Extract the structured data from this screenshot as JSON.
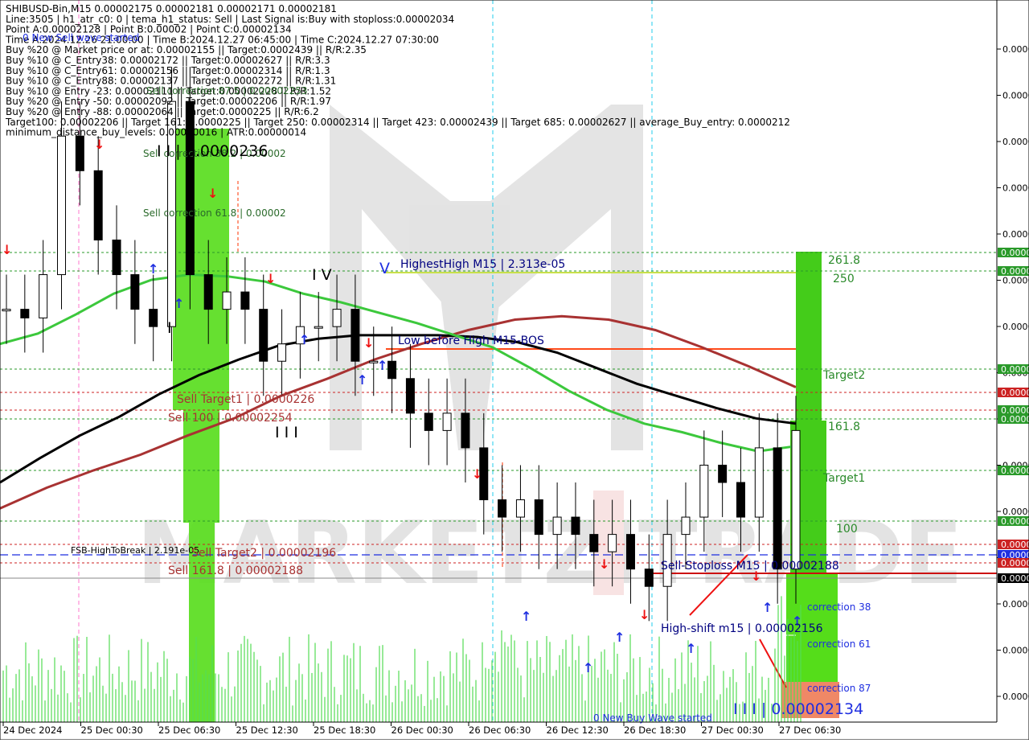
{
  "header_lines": [
    "SHIBUSD-Bin,M15  0.00002175 0.00002181 0.00002171 0.00002181",
    "Line:3505 | h1_atr_c0: 0 | tema_h1_status: Sell | Last Signal is:Buy with stoploss:0.00002034",
    "Point A:0.00002128 | Point B:0.00002 | Point C:0.00002134",
    "Time A:2024.12.26 21:00:00 | Time B:2024.12.27 06:45:00 | Time C:2024.12.27 07:30:00",
    "Buy %20 @ Market price or at: 0.00002155 || Target:0.0002439 || R/R:2.35",
    "Buy %10 @ C_Entry38: 0.00002172 || Target:0.00002627 || R/R:3.3",
    "Buy %10 @ C_Entry61: 0.00002156 || Target:0.00002314 || R/R:1.3",
    "Buy %10 @ C_Entry88: 0.00002137 || Target:0.00002272 || R/R:1.31",
    "Buy %10 @ Entry -23: 0.00002111 || Target:0.00002228 || R/R:1.52",
    "Buy %20 @ Entry -50: 0.00002092 || Target:0.00002206 || R/R:1.97",
    "Buy %20 @ Entry -88: 0.00002064 || Target:0.0000225 || R/R:6.2",
    "Target100: 0.00002206 || Target 161: 0.0000225 || Target 250: 0.00002314 || Target 423: 0.00002439 || Target 685: 0.00002627 || average_Buy_entry: 0.0000212",
    "minimum_distance_buy_levels: 0.00000016 | ATR:0.00000014"
  ],
  "chart_data": {
    "type": "candlestick",
    "symbol": "SHIBUSD-Bin",
    "timeframe": "M15",
    "ohlc_last": [
      2.175e-05,
      2.181e-05,
      2.171e-05,
      2.181e-05
    ],
    "x_ticks": [
      "24 Dec 2024",
      "25 Dec 00:30",
      "25 Dec 06:30",
      "25 Dec 12:30",
      "25 Dec 18:30",
      "26 Dec 00:30",
      "26 Dec 06:30",
      "26 Dec 12:30",
      "26 Dec 18:30",
      "27 Dec 00:30",
      "27 Dec 06:30"
    ],
    "y_tick_labels": [
      "0.0000",
      "0.0000",
      "0.0000",
      "0.0000",
      "0.0000",
      "0.0000",
      "0.0000",
      "0.0000",
      "0.0000",
      "0.0000",
      "0.0000",
      "0.0000",
      "0.0000",
      "0.0000",
      "0.0000",
      "0.0000"
    ],
    "price_tags": [
      {
        "text": "0.0000",
        "color": "#2a9a2a"
      },
      {
        "text": "0.0000",
        "color": "#2a9a2a"
      },
      {
        "text": "0.0000",
        "color": "#2a9a2a"
      },
      {
        "text": "0.0000",
        "color": "#cc2222"
      },
      {
        "text": "0.0000",
        "color": "#2a9a2a"
      },
      {
        "text": "0.0000",
        "color": "#2a9a2a"
      },
      {
        "text": "0.0000",
        "color": "#2a9a2a"
      },
      {
        "text": "0.0000",
        "color": "#2a9a2a"
      },
      {
        "text": "0.0000",
        "color": "#cc2222"
      },
      {
        "text": "0.0000",
        "color": "#1f2fe0"
      },
      {
        "text": "0.0000",
        "color": "#cc2222"
      },
      {
        "text": "0.0000",
        "color": "#000000"
      }
    ],
    "series": [
      {
        "kind": "ma-green",
        "color": "#3cc83c",
        "values": [
          2.22e-05,
          2.226e-05,
          2.237e-05,
          2.249e-05,
          2.257e-05,
          2.26e-05,
          2.259e-05,
          2.256e-05,
          2.249e-05,
          2.244e-05,
          2.238e-05,
          2.232e-05,
          2.225e-05,
          2.218e-05,
          2.206e-05,
          2.193e-05,
          2.182e-05,
          2.174e-05,
          2.169e-05,
          2.163e-05,
          2.158e-05,
          2.161e-05
        ]
      },
      {
        "kind": "ma-black",
        "color": "#000000",
        "values": [
          2.14e-05,
          2.154e-05,
          2.167e-05,
          2.178e-05,
          2.191e-05,
          2.202e-05,
          2.211e-05,
          2.219e-05,
          2.223e-05,
          2.225e-05,
          2.225e-05,
          2.225e-05,
          2.224e-05,
          2.221e-05,
          2.215e-05,
          2.206e-05,
          2.197e-05,
          2.19e-05,
          2.183e-05,
          2.177e-05,
          2.174e-05
        ]
      },
      {
        "kind": "ma-red",
        "color": "#a83232",
        "values": [
          2.125e-05,
          2.137e-05,
          2.147e-05,
          2.156e-05,
          2.167e-05,
          2.177e-05,
          2.19e-05,
          2.2e-05,
          2.211e-05,
          2.22e-05,
          2.228e-05,
          2.234e-05,
          2.236e-05,
          2.234e-05,
          2.228e-05,
          2.218e-05,
          2.207e-05,
          2.195e-05
        ]
      }
    ],
    "close": [
      2.24e-05,
      2.235e-05,
      2.26e-05,
      2.34e-05,
      2.32e-05,
      2.28e-05,
      2.26e-05,
      2.24e-05,
      2.23e-05,
      2.36e-05,
      2.26e-05,
      2.24e-05,
      2.25e-05,
      2.24e-05,
      2.21e-05,
      2.22e-05,
      2.23e-05,
      2.23e-05,
      2.24e-05,
      2.21e-05,
      2.21e-05,
      2.2e-05,
      2.18e-05,
      2.17e-05,
      2.18e-05,
      2.16e-05,
      2.13e-05,
      2.12e-05,
      2.13e-05,
      2.11e-05,
      2.12e-05,
      2.11e-05,
      2.1e-05,
      2.11e-05,
      2.09e-05,
      2.08e-05,
      2.11e-05,
      2.12e-05,
      2.15e-05,
      2.14e-05,
      2.12e-05,
      2.16e-05,
      2.09e-05,
      2.17e-05
    ],
    "levels": [
      {
        "label": "HighestHigh   M15 | 2.313e-05",
        "color": "#c8e04a"
      },
      {
        "label": "Low before High   M15-BOS",
        "color": "#ff4a1a"
      },
      {
        "label": "Sell-Stoploss M15 | 0.00002188",
        "color": "#cc1111"
      },
      {
        "label": "FSB-HighToBreak | 2.191e-05",
        "color": "#1f2fe0"
      },
      {
        "label": "High-shift m15 | 0.00002156",
        "color": "#000000"
      }
    ],
    "annotations": [
      "Sell Target1 | 0.0000226",
      "Sell 100 | 0.00002254",
      "Sell Target2 | 0.00002196",
      "Sell 161.8 | 0.00002188",
      "Sell correction 38.2 | 0.00002",
      "Sell correction 61.8 | 0.00002",
      "Sell correction 87.5 | 0.00002253",
      "0 New Sell wave started",
      "0 New Buy Wave started",
      "I I | 0.0000236",
      "I I I | 0.00002134",
      "261.8",
      "250",
      "Target2",
      "161.8",
      "Target1",
      "100",
      "correction 38",
      "correction 61",
      "correction 87",
      "I",
      "I V",
      "V",
      "I I I"
    ],
    "watermark": "MARKETZITRADE"
  }
}
